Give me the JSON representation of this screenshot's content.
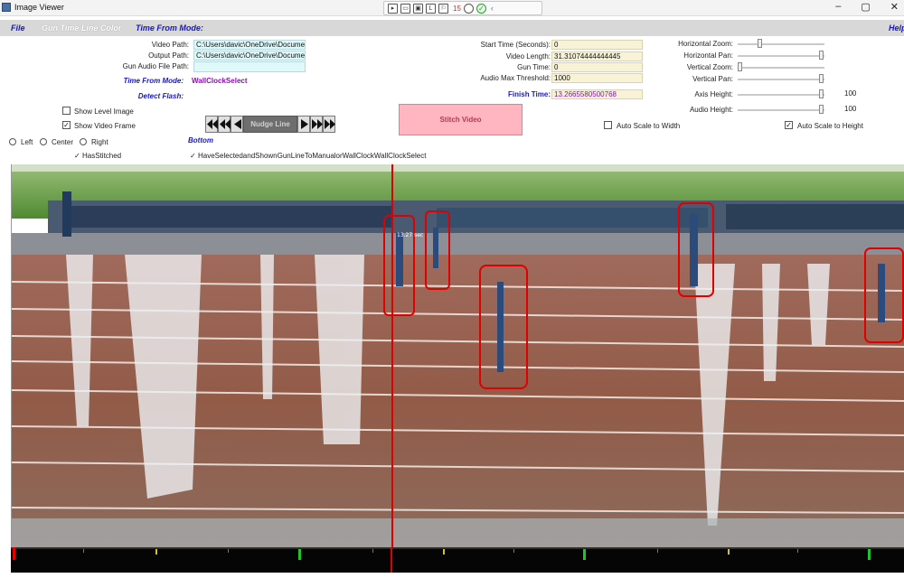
{
  "window": {
    "title": "Image Viewer",
    "minimize": "–",
    "maximize": "▢",
    "close": "✕"
  },
  "toolbar": {
    "count": "15"
  },
  "menu": {
    "file": "File",
    "gun_time_line_color": "Gun Time Line Color",
    "time_from_mode": "Time From Mode:",
    "help": "Help"
  },
  "form": {
    "video_path_label": "Video Path:",
    "video_path_value": "C:\\Users\\davic\\OneDrive\\Documents",
    "output_path_label": "Output Path:",
    "output_path_value": "C:\\Users\\davic\\OneDrive\\Documents",
    "gun_audio_label": "Gun Audio File Path:",
    "gun_audio_value": "",
    "time_from_mode_label": "Time From Mode:",
    "time_from_mode_value": "WallClockSelect",
    "detect_flash_label": "Detect Flash:",
    "show_level_image": "Show Level Image",
    "show_video_frame": "Show Video Frame",
    "nudge_line": "Nudge Line",
    "bottom_label": "Bottom",
    "has_stitched": "HasStitched",
    "have_selected": "HaveSelectedandShownGunLineToManualorWallClockWallClockSelect",
    "align_left": "Left",
    "align_center": "Center",
    "align_right": "Right",
    "start_time_label": "Start Time (Seconds):",
    "start_time_value": "0",
    "video_length_label": "Video Length:",
    "video_length_value": "31.31074444444445",
    "gun_time_label": "Gun Time:",
    "gun_time_value": "0",
    "audio_max_label": "Audio Max Threshold:",
    "audio_max_value": "1000",
    "finish_time_label": "Finish Time:",
    "finish_time_value": "13.2665580500768",
    "stitch_video": "Stitch Video",
    "horizontal_zoom": "Horizontal Zoom:",
    "horizontal_pan": "Horizontal Pan:",
    "vertical_zoom": "Vertical Zoom:",
    "vertical_pan": "Vertical Pan:",
    "axis_height": "Axis Height:",
    "axis_height_value": "100",
    "audio_height": "Audio Height:",
    "audio_height_value": "100",
    "auto_scale_width": "Auto Scale to Width",
    "auto_scale_height": "Auto Scale to Height"
  },
  "image": {
    "time_marker": "13.27 sec"
  },
  "colors": {
    "gun_line": "#e00000",
    "highlight_box": "#e00000",
    "track": "#9a5c4c",
    "grass": "#5d9a3c",
    "menu_text": "#1717c9"
  }
}
